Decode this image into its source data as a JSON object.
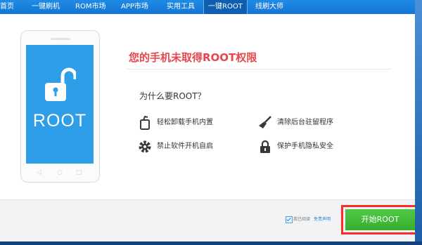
{
  "nav": {
    "tabs": [
      {
        "label": "首页"
      },
      {
        "label": "一键刷机"
      },
      {
        "label": "ROM市场"
      },
      {
        "label": "APP市场"
      },
      {
        "label": "实用工具"
      },
      {
        "label": "一键ROOT",
        "active": true
      },
      {
        "label": "线刷大师"
      }
    ]
  },
  "phone": {
    "screen_label": "ROOT",
    "icon": "unlocked-padlock-icon"
  },
  "main": {
    "title": "您的手机未取得ROOT权限",
    "subtitle": "为什么要ROOT？",
    "features": [
      {
        "label": "轻松卸载手机内置",
        "icon": "trash-icon"
      },
      {
        "label": "清除后台驻留程序",
        "icon": "broom-icon"
      },
      {
        "label": "禁止软件开机自启",
        "icon": "gear-icon"
      },
      {
        "label": "保护手机隐私安全",
        "icon": "lock-icon"
      }
    ]
  },
  "footer": {
    "agree_label": "我已阅读",
    "agree_link": "免责声明",
    "agree_checked": true,
    "start_label": "开始ROOT"
  },
  "colors": {
    "accent": "#1677d2",
    "title_red": "#e8464d",
    "button_green": "#3cb233",
    "highlight": "#ff2a2a",
    "phone_screen": "#2e9ee8"
  }
}
